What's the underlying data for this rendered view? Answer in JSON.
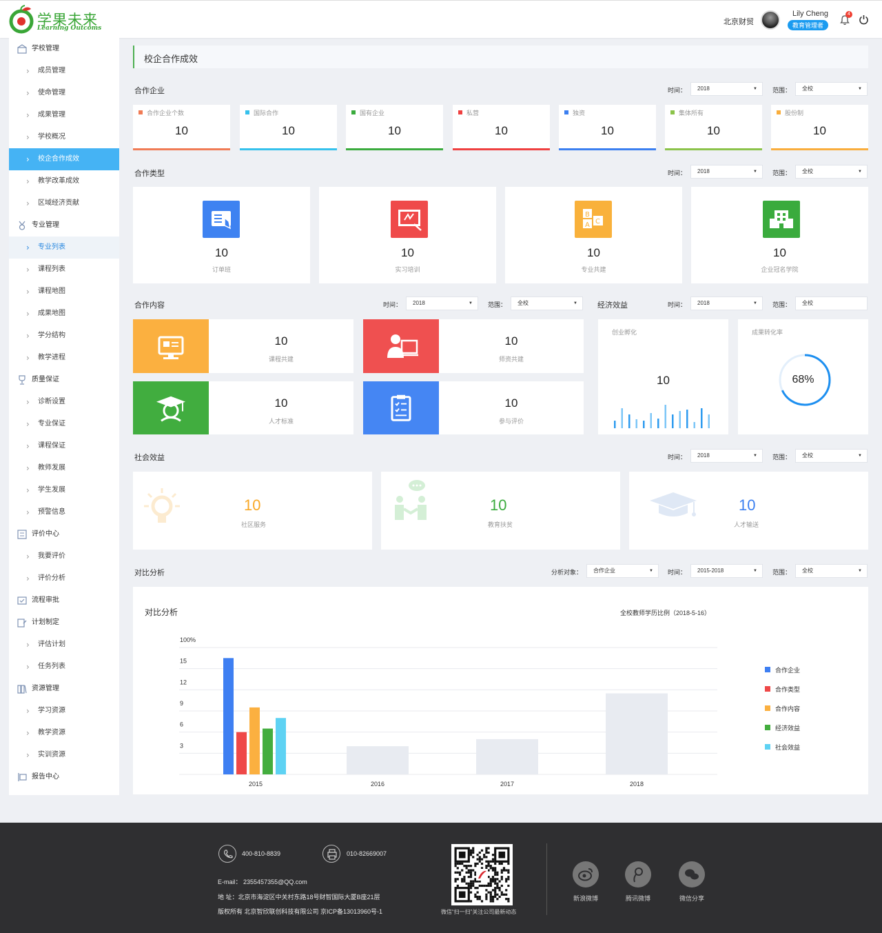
{
  "brand": {
    "name_cn": "学果未来",
    "name_en": "Learning Outcoms"
  },
  "header": {
    "org": "北京财贸",
    "user_name": "Lily Cheng",
    "user_role": "教育管理者",
    "notifications": "4"
  },
  "sidebar": {
    "groups": [
      {
        "label": "学校管理",
        "icon": "school-icon",
        "items": [
          "成员管理",
          "使命管理",
          "成果管理",
          "学校概况",
          "校企合作成效",
          "教学改革成效",
          "区域经济贡献"
        ]
      },
      {
        "label": "专业管理",
        "icon": "medal-icon",
        "items": [
          "专业列表",
          "课程列表",
          "课程地图",
          "成果地图",
          "学分结构",
          "教学进程"
        ]
      },
      {
        "label": "质量保证",
        "icon": "trophy-icon",
        "items": [
          "诊断设置",
          "专业保证",
          "课程保证",
          "教师发展",
          "学生发展",
          "预警信息"
        ]
      },
      {
        "label": "评价中心",
        "icon": "list-icon",
        "items": [
          "我要评价",
          "评价分析"
        ]
      },
      {
        "label": "流程审批",
        "icon": "approval-icon",
        "items": []
      },
      {
        "label": "计划制定",
        "icon": "plan-icon",
        "items": [
          "评估计划",
          "任务列表"
        ]
      },
      {
        "label": "资源管理",
        "icon": "resource-icon",
        "items": [
          "学习资源",
          "教学资源",
          "实训资源"
        ]
      },
      {
        "label": "报告中心",
        "icon": "report-icon",
        "items": []
      }
    ],
    "active_item": "校企合作成效",
    "highlight_item": "专业列表"
  },
  "page": {
    "title": "校企合作成效"
  },
  "filters": {
    "time_label": "时间：",
    "scope_label": "范围：",
    "year": "2018",
    "scope": "全校",
    "analysis_label": "分析对象：",
    "analysis_target": "合作企业",
    "year_range": "2015-2018"
  },
  "partners": {
    "title": "合作企业",
    "cards": [
      {
        "label": "合作企业个数",
        "value": "10",
        "color": "#f07b55"
      },
      {
        "label": "国际合作",
        "value": "10",
        "color": "#35c1ec"
      },
      {
        "label": "国有企业",
        "value": "10",
        "color": "#3aab3d"
      },
      {
        "label": "私营",
        "value": "10",
        "color": "#ef4040"
      },
      {
        "label": "独资",
        "value": "10",
        "color": "#3b7ff0"
      },
      {
        "label": "集体所有",
        "value": "10",
        "color": "#8bc34a"
      },
      {
        "label": "股份制",
        "value": "10",
        "color": "#f9ad3c"
      }
    ]
  },
  "types": {
    "title": "合作类型",
    "cards": [
      {
        "label": "订单班",
        "value": "10",
        "color": "#3e82f1",
        "icon": "order-class-icon"
      },
      {
        "label": "实习培训",
        "value": "10",
        "color": "#ef4a4a",
        "icon": "training-board-icon"
      },
      {
        "label": "专业共建",
        "value": "10",
        "color": "#f9b13b",
        "icon": "abc-blocks-icon"
      },
      {
        "label": "企业冠名学院",
        "value": "10",
        "color": "#3aab3d",
        "icon": "building-icon"
      }
    ]
  },
  "content": {
    "title": "合作内容",
    "cards": [
      {
        "label": "课程共建",
        "value": "10",
        "color": "#fbb040",
        "icon": "monitor-icon"
      },
      {
        "label": "师资共建",
        "value": "10",
        "color": "#ef5050",
        "icon": "teacher-icon"
      },
      {
        "label": "人才标准",
        "value": "10",
        "color": "#41ad3f",
        "icon": "graduate-icon"
      },
      {
        "label": "参与评价",
        "value": "10",
        "color": "#4586f3",
        "icon": "clipboard-icon"
      }
    ]
  },
  "economy": {
    "title": "经济效益",
    "incubation": {
      "label": "创业孵化",
      "value": "10",
      "bars": [
        0.3,
        0.8,
        0.55,
        0.35,
        0.3,
        0.6,
        0.4,
        0.95,
        0.55,
        0.7,
        0.75,
        0.25,
        0.8,
        0.55
      ]
    },
    "conversion": {
      "label": "成果转化率",
      "value": "68%",
      "fraction": 0.68
    }
  },
  "social": {
    "title": "社会效益",
    "cards": [
      {
        "label": "社区服务",
        "value": "10",
        "color": "#f9a825",
        "icon": "lightbulb-icon"
      },
      {
        "label": "教育扶贫",
        "value": "10",
        "color": "#3aab3d",
        "icon": "handshake-icon"
      },
      {
        "label": "人才输送",
        "value": "10",
        "color": "#3b7ff0",
        "icon": "graduation-cap-icon"
      }
    ]
  },
  "compare": {
    "title": "对比分析",
    "card_title": "对比分析",
    "subtitle": "全校教师学历比例（2018-5-16）"
  },
  "chart_data": {
    "type": "bar",
    "categories": [
      "2015",
      "2016",
      "2017",
      "2018"
    ],
    "y_ticks": [
      "100%",
      "15",
      "12",
      "9",
      "6",
      "3"
    ],
    "ylim": [
      0,
      18
    ],
    "series": [
      {
        "name": "合作企业",
        "color": "#3e7ff2",
        "values": [
          16.5,
          null,
          null,
          null
        ]
      },
      {
        "name": "合作类型",
        "color": "#ef4848",
        "values": [
          6.0,
          null,
          null,
          null
        ]
      },
      {
        "name": "合作内容",
        "color": "#fbb040",
        "values": [
          9.5,
          null,
          null,
          null
        ]
      },
      {
        "name": "经济效益",
        "color": "#43ad3e",
        "values": [
          6.5,
          null,
          null,
          null
        ]
      },
      {
        "name": "社会效益",
        "color": "#5ed2f3",
        "values": [
          8.0,
          null,
          null,
          null
        ]
      }
    ],
    "totals": {
      "color": "#e8ebf1",
      "values": [
        null,
        4.0,
        5.0,
        11.5
      ]
    }
  },
  "footer": {
    "phone": "400-810-8839",
    "fax": "010-82669007",
    "email_label": "E-mail：",
    "email": "2355457355@QQ.com",
    "address": "地 址：北京市海淀区中关村东路18号财智国际大厦B座21层",
    "copyright": "版权所有 北京智欣联创科技有限公司 京ICP备13013960号-1",
    "qr_caption": "微信“扫一扫”关注公司最新动态",
    "social": [
      "新浪微博",
      "腾讯微博",
      "微信分享"
    ]
  }
}
